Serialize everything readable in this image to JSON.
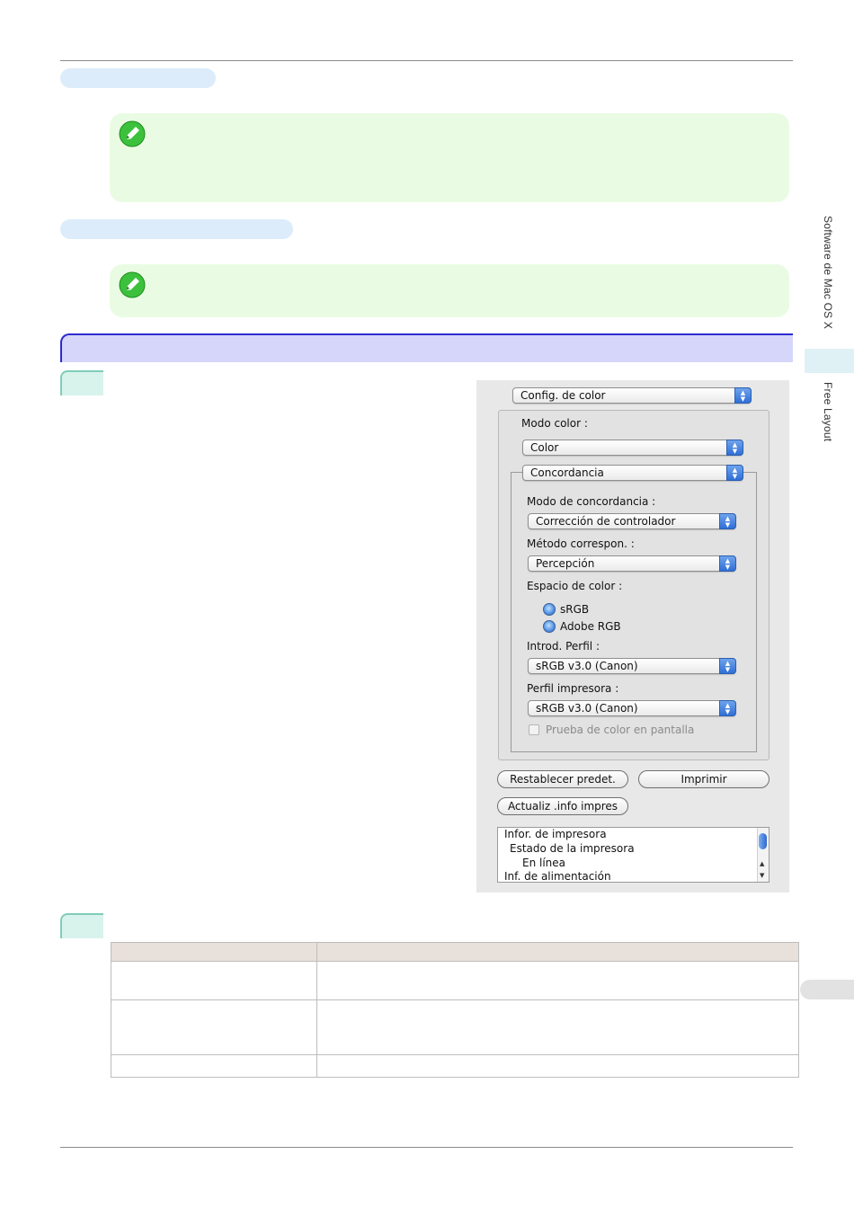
{
  "side": {
    "title": "Software de Mac OS X",
    "section": "Free Layout"
  },
  "icons": {
    "note_icon": "note-pencil-icon",
    "popup_icon": "updown-arrows-icon",
    "radio_icon": "radio-button",
    "scroll_icon": "scrollbar"
  },
  "dialog": {
    "panel_popup": "Config. de color",
    "color_mode_label": "Modo color :",
    "color_mode_value": "Color",
    "matching_popup": "Concordancia",
    "matching_mode_label": "Modo de concordancia :",
    "matching_mode_value": "Corrección de controlador",
    "matching_method_label": "Método correspon. :",
    "matching_method_value": "Percepción",
    "color_space_label": "Espacio de color :",
    "color_space_options": [
      "sRGB",
      "Adobe RGB"
    ],
    "input_profile_label": "Introd. Perfil :",
    "input_profile_value": "sRGB v3.0 (Canon)",
    "printer_profile_label": "Perfil impresora :",
    "printer_profile_value": "sRGB v3.0 (Canon)",
    "softproof_label": "Prueba de color en pantalla",
    "reset_button": "Restablecer predet.",
    "print_button": "Imprimir",
    "update_button": "Actualiz .info impres",
    "info_lines": [
      "Infor. de impresora",
      "Estado de la impresora",
      "En línea",
      "Inf. de alimentación"
    ]
  },
  "colors": {
    "section_bar": "#d6d6fb",
    "section_border": "#2b2bd0",
    "note_bg": "#e9fce3",
    "pill_bg": "#dcecfb",
    "step_tab": "#d8f3ec"
  }
}
